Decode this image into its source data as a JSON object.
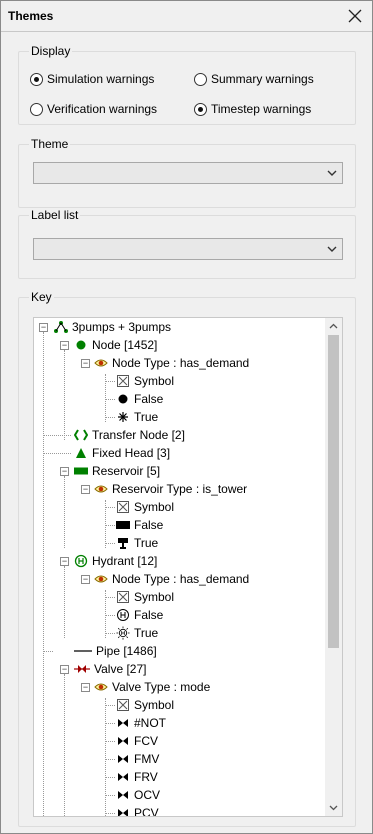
{
  "window": {
    "title": "Themes"
  },
  "display": {
    "label": "Display",
    "options": [
      {
        "label": "Simulation warnings",
        "checked": true
      },
      {
        "label": "Summary warnings",
        "checked": false
      },
      {
        "label": "Verification warnings",
        "checked": false
      },
      {
        "label": "Timestep warnings",
        "checked": true
      }
    ]
  },
  "theme": {
    "label": "Theme",
    "value": ""
  },
  "labellist": {
    "label": "Label list",
    "value": ""
  },
  "key": {
    "label": "Key",
    "tree": [
      {
        "label": "3pumps + 3pumps",
        "icon": "network-icon"
      },
      {
        "label": "Node [1452]",
        "icon": "node-icon"
      },
      {
        "label": "Node Type : has_demand",
        "icon": "theme-eye-icon"
      },
      {
        "label": "Symbol",
        "icon": "symbol-icon"
      },
      {
        "label": "False",
        "icon": "black-dot-icon"
      },
      {
        "label": "True",
        "icon": "asterisk-icon"
      },
      {
        "label": "Transfer Node [2]",
        "icon": "transfer-node-icon"
      },
      {
        "label": "Fixed Head [3]",
        "icon": "fixed-head-icon"
      },
      {
        "label": "Reservoir [5]",
        "icon": "reservoir-icon"
      },
      {
        "label": "Reservoir Type : is_tower",
        "icon": "theme-eye-icon"
      },
      {
        "label": "Symbol",
        "icon": "symbol-icon"
      },
      {
        "label": "False",
        "icon": "black-rect-icon"
      },
      {
        "label": "True",
        "icon": "tower-icon"
      },
      {
        "label": "Hydrant [12]",
        "icon": "hydrant-icon"
      },
      {
        "label": "Node Type : has_demand",
        "icon": "theme-eye-icon"
      },
      {
        "label": "Symbol",
        "icon": "symbol-icon"
      },
      {
        "label": "False",
        "icon": "hydrant-outline-icon"
      },
      {
        "label": "True",
        "icon": "hydrant-burst-icon"
      },
      {
        "label": "Pipe [1486]",
        "icon": "pipe-line-icon"
      },
      {
        "label": "Valve [27]",
        "icon": "valve-icon"
      },
      {
        "label": "Valve Type : mode",
        "icon": "theme-eye-icon"
      },
      {
        "label": "Symbol",
        "icon": "symbol-icon"
      },
      {
        "label": "#NOT",
        "icon": "valve-black-icon"
      },
      {
        "label": "FCV",
        "icon": "valve-black-icon"
      },
      {
        "label": "FMV",
        "icon": "valve-black-icon"
      },
      {
        "label": "FRV",
        "icon": "valve-black-icon"
      },
      {
        "label": "OCV",
        "icon": "valve-black-icon"
      },
      {
        "label": "PCV",
        "icon": "valve-black-icon"
      }
    ]
  },
  "colors": {
    "node": "#008000",
    "valve": "#a00000",
    "accent": "#0078d7"
  }
}
